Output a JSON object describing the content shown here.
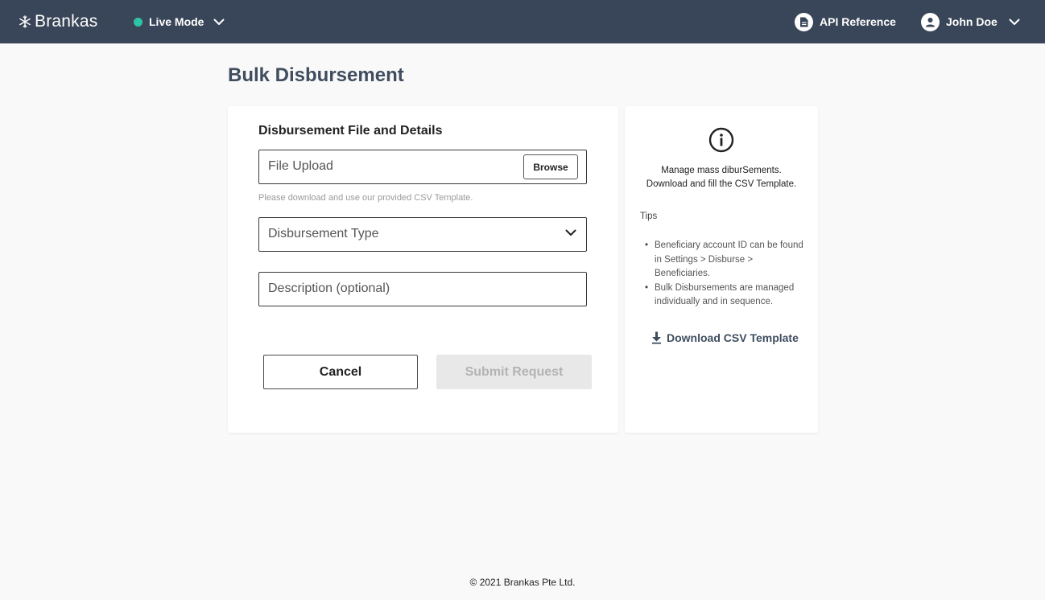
{
  "header": {
    "brand": "Brankas",
    "mode_label": "Live Mode",
    "api_reference_label": "API Reference",
    "user_name": "John Doe"
  },
  "page": {
    "title": "Bulk Disbursement"
  },
  "form": {
    "card_title": "Disbursement File and Details",
    "file_upload_placeholder": "File Upload",
    "browse_label": "Browse",
    "helper_text": "Please download and use our provided CSV Template.",
    "type_placeholder": "Disbursement Type",
    "description_placeholder": "Description (optional)",
    "cancel_label": "Cancel",
    "submit_label": "Submit Request"
  },
  "side": {
    "summary_line1": "Manage mass diburSements.",
    "summary_line2": "Download and fill the CSV Template.",
    "tips_title": "Tips",
    "tips": [
      "Beneficiary account ID can be found in Settings > Disburse > Beneficiaries.",
      "Bulk Disbursements are managed individually and in sequence."
    ],
    "download_label": "Download CSV Template"
  },
  "footer": {
    "copyright": "© 2021 Brankas Pte Ltd."
  },
  "colors": {
    "header_bg": "#394558",
    "live_dot": "#2ec4a6",
    "page_bg": "#f9f9f9",
    "title_text": "#3f4d5f",
    "disabled_bg": "#e8e8e8"
  },
  "icons": {
    "brand": "snowflake-logo-icon",
    "mode_dropdown": "chevron-down-icon",
    "api_reference": "document-icon",
    "user": "user-circle-icon",
    "user_dropdown": "chevron-down-icon",
    "type_dropdown": "chevron-down-icon",
    "info": "info-circle-icon",
    "download": "download-icon"
  }
}
